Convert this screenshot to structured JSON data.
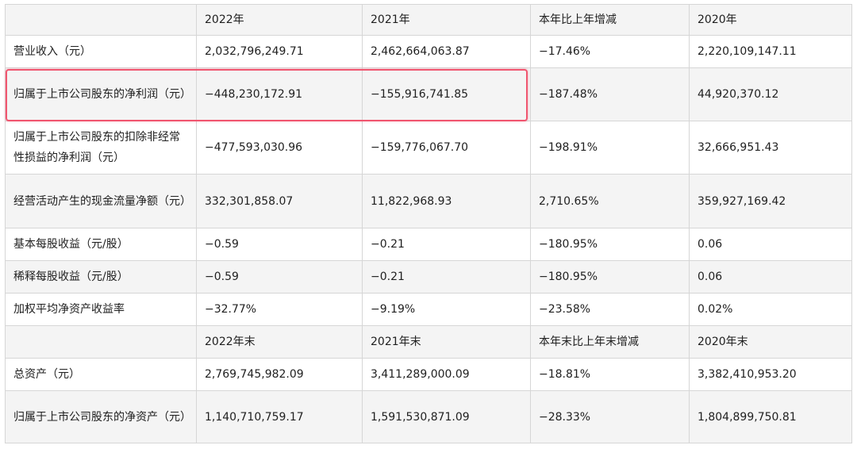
{
  "header1": [
    "",
    "2022年",
    "2021年",
    "本年比上年增减",
    "2020年"
  ],
  "rows1": [
    [
      "营业收入（元）",
      "2,032,796,249.71",
      "2,462,664,063.87",
      "−17.46%",
      "2,220,109,147.11"
    ],
    [
      "归属于上市公司股东的净利润（元）",
      "−448,230,172.91",
      "−155,916,741.85",
      "−187.48%",
      "44,920,370.12"
    ],
    [
      "归属于上市公司股东的扣除非经常性损益的净利润（元）",
      "−477,593,030.96",
      "−159,776,067.70",
      "−198.91%",
      "32,666,951.43"
    ],
    [
      "经营活动产生的现金流量净额（元）",
      "332,301,858.07",
      "11,822,968.93",
      "2,710.65%",
      "359,927,169.42"
    ],
    [
      "基本每股收益（元/股）",
      "−0.59",
      "−0.21",
      "−180.95%",
      "0.06"
    ],
    [
      "稀释每股收益（元/股）",
      "−0.59",
      "−0.21",
      "−180.95%",
      "0.06"
    ],
    [
      "加权平均净资产收益率",
      "−32.77%",
      "−9.19%",
      "−23.58%",
      "0.02%"
    ]
  ],
  "header2": [
    "",
    "2022年末",
    "2021年末",
    "本年末比上年末增减",
    "2020年末"
  ],
  "rows2": [
    [
      "总资产（元）",
      "2,769,745,982.09",
      "3,411,289,000.09",
      "−18.81%",
      "3,382,410,953.20"
    ],
    [
      "归属于上市公司股东的净资产（元）",
      "1,140,710,759.17",
      "1,591,530,871.09",
      "−28.33%",
      "1,804,899,750.81"
    ]
  ]
}
